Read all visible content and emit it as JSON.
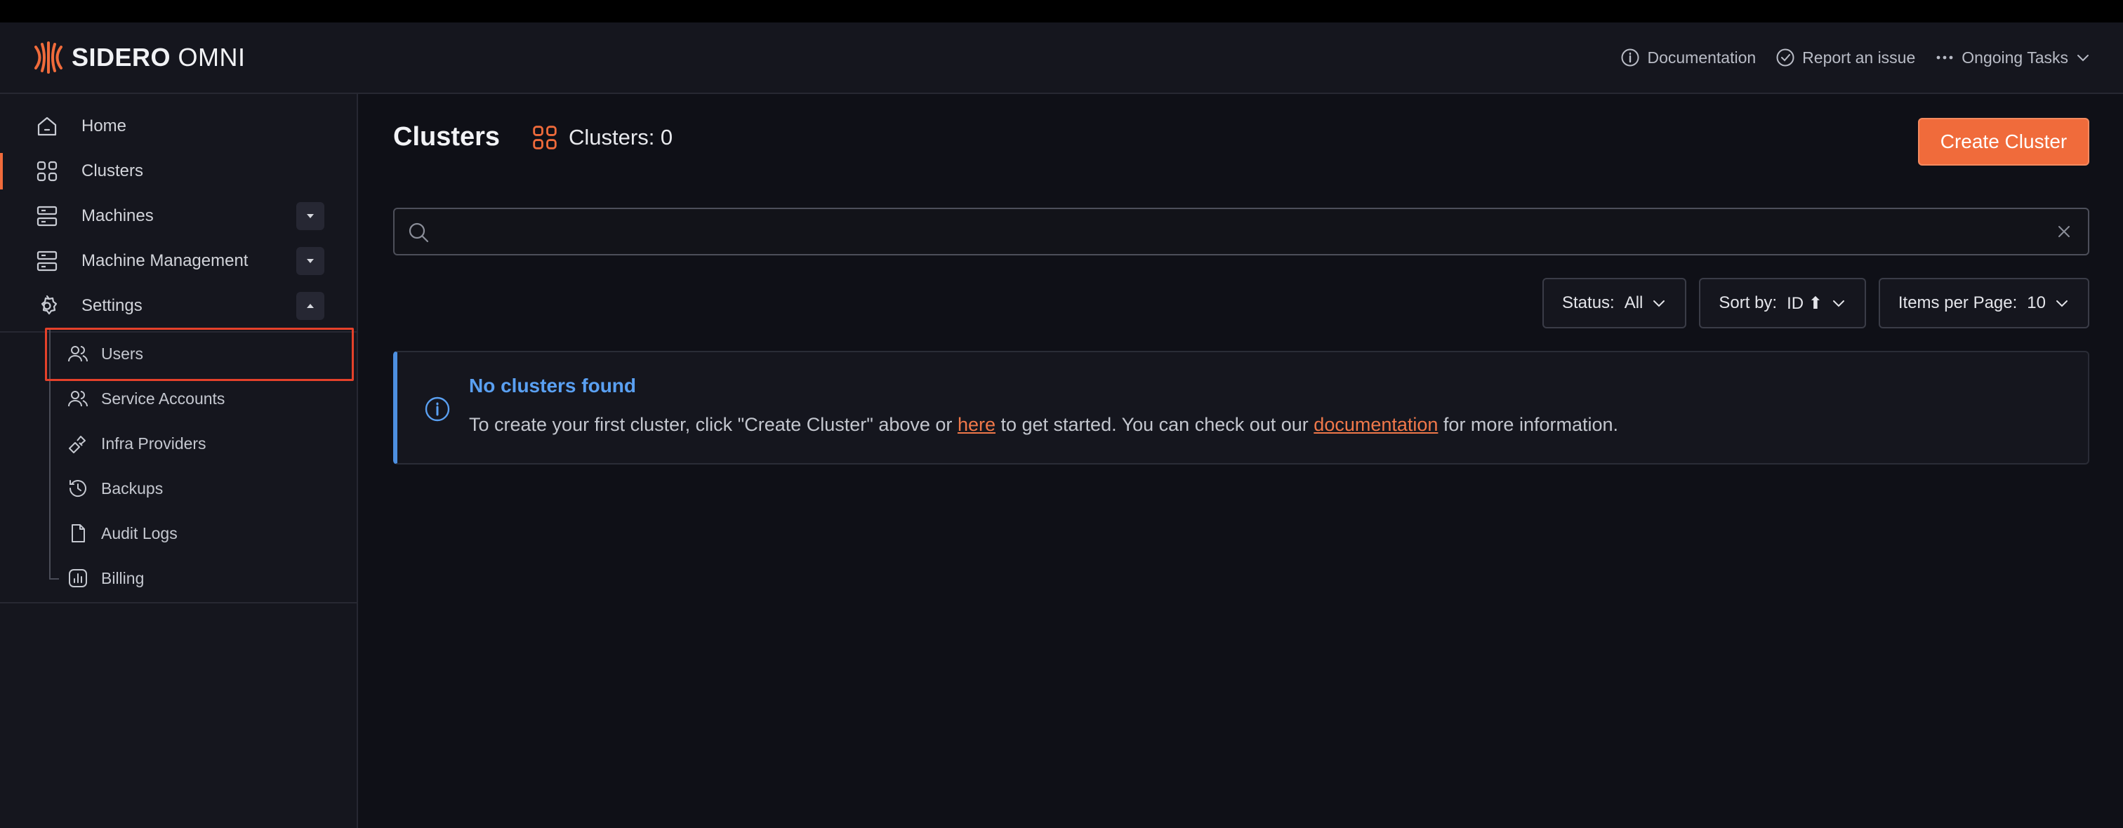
{
  "brand": {
    "name_bold": "SIDERO",
    "name_light": "OMNI"
  },
  "header": {
    "links": [
      {
        "label": "Documentation",
        "icon": "info-circle-icon"
      },
      {
        "label": "Report an issue",
        "icon": "check-circle-icon"
      },
      {
        "label": "Ongoing Tasks",
        "icon": "ellipsis-icon"
      }
    ]
  },
  "sidebar": {
    "items": [
      {
        "label": "Home",
        "icon": "home-icon"
      },
      {
        "label": "Clusters",
        "icon": "grid-icon"
      },
      {
        "label": "Machines",
        "icon": "server-icon"
      },
      {
        "label": "Machine Management",
        "icon": "server-icon"
      },
      {
        "label": "Settings",
        "icon": "gear-icon"
      }
    ],
    "settings_children": [
      {
        "label": "Users",
        "icon": "users-icon"
      },
      {
        "label": "Service Accounts",
        "icon": "users-icon"
      },
      {
        "label": "Infra Providers",
        "icon": "provider-icon"
      },
      {
        "label": "Backups",
        "icon": "history-icon"
      },
      {
        "label": "Audit Logs",
        "icon": "file-icon"
      },
      {
        "label": "Billing",
        "icon": "billing-icon"
      }
    ]
  },
  "main": {
    "title": "Clusters",
    "count_label": "Clusters: 0",
    "create_button": "Create Cluster",
    "search": {
      "value": "",
      "placeholder": ""
    },
    "filters": [
      {
        "label": "Status:",
        "value": "All"
      },
      {
        "label": "Sort by:",
        "value": "ID ⬆"
      },
      {
        "label": "Items per Page:",
        "value": "10"
      }
    ],
    "alert": {
      "title": "No clusters found",
      "body_1": "To create your first cluster, click \"Create Cluster\" above or ",
      "link_1": "here",
      "body_2": " to get started. You can check out our ",
      "link_2": "documentation",
      "body_3": " for more information."
    }
  },
  "colors": {
    "accent": "#f06b3b",
    "info": "#5aa0f2",
    "background": "#0f1017",
    "panel": "#15161e"
  }
}
